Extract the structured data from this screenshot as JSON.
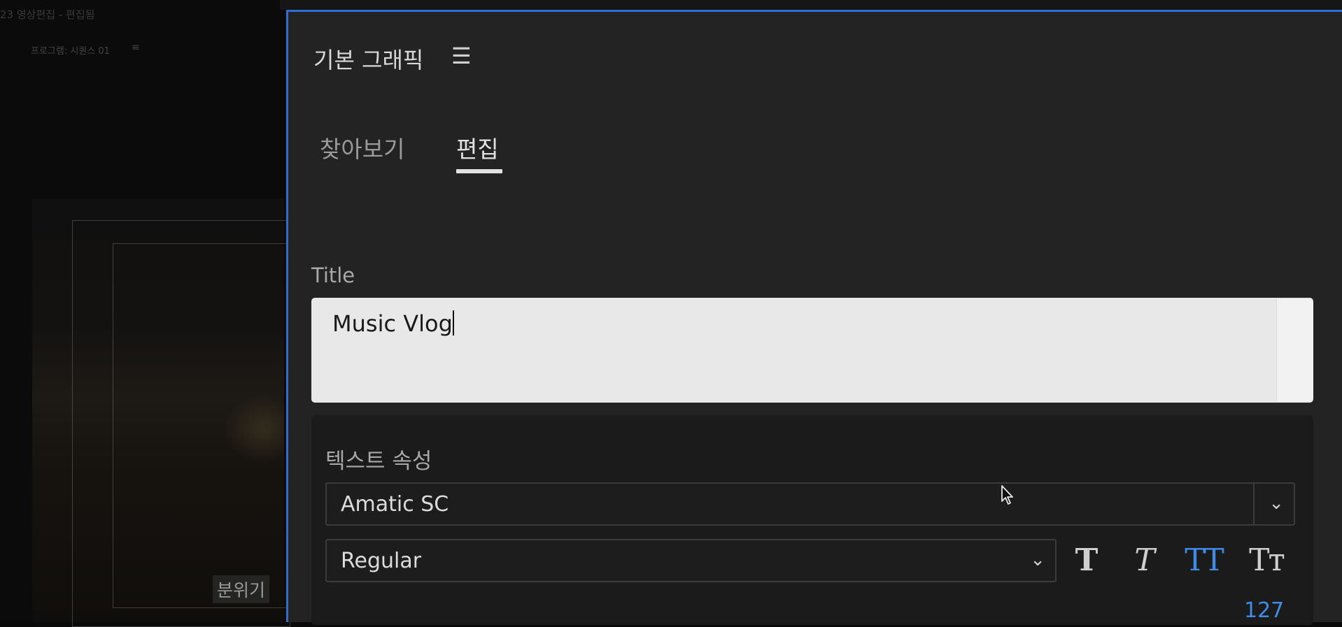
{
  "background": {
    "project_title": "23 영상편집 - 편집됨",
    "monitor_label": "프로그램: 시퀀스 01",
    "monitor_menu_icon": "≡",
    "caption": "분위기"
  },
  "panel": {
    "title": "기본 그래픽",
    "menu_icon": "☰",
    "tabs": [
      {
        "label": "찾아보기",
        "active": false
      },
      {
        "label": "편집",
        "active": true
      }
    ],
    "title_field": {
      "label": "Title",
      "value": "Music Vlog"
    },
    "text_properties": {
      "heading": "텍스트 속성",
      "font": "Amatic SC",
      "style": "Regular",
      "chevron_icon": "⌄",
      "format_buttons": [
        {
          "name": "faux-bold",
          "label": "T",
          "active": false
        },
        {
          "name": "faux-italic",
          "label": "T",
          "active": false
        },
        {
          "name": "all-caps",
          "label": "TT",
          "active": true
        },
        {
          "name": "small-caps",
          "label": "Tт",
          "active": false
        }
      ],
      "value": "127"
    }
  },
  "colors": {
    "panel_border": "#2c6fd0",
    "accent": "#3f8be8",
    "panel_bg": "#232323"
  }
}
